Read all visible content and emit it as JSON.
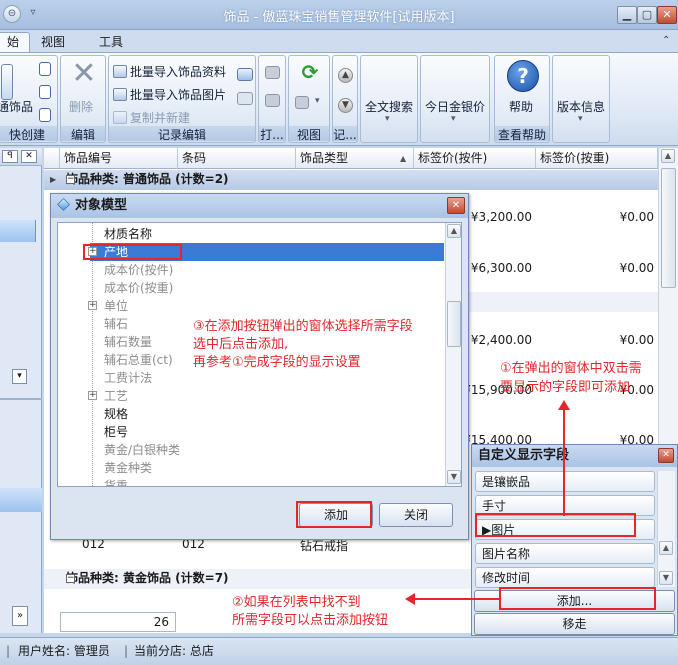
{
  "window": {
    "title": "饰品 - 傲蓝珠宝销售管理软件[试用版本]",
    "min": "▁",
    "max": "▢",
    "close": "✕"
  },
  "tabs": [
    {
      "label": "始"
    },
    {
      "label": "视图"
    },
    {
      "label": "工具"
    }
  ],
  "ribbon": {
    "create_cut": "通饰品",
    "create_group": "快创建",
    "delete": "删除",
    "edit_group": "编辑",
    "import_info": "批量导入饰品资料",
    "import_image": "批量导入饰品图片",
    "copy_new": "复制并新建",
    "record_group": "记录编辑",
    "print_group": "打...",
    "view_group": "视图",
    "record_group2": "记...",
    "fulltext_search": "全文搜索",
    "gold_price": "今日金银价",
    "help": "帮助",
    "view_help_group": "查看帮助",
    "version_info": "版本信息"
  },
  "left_pane": {
    "pin": "ꟼ",
    "close": "✕",
    "page_count": "26"
  },
  "grid": {
    "columns": [
      "饰品编号",
      "条码",
      "饰品类型",
      "标签价(按件)",
      "标签价(按重)"
    ],
    "group1": "饰品种类: 普通饰品 (计数=2)",
    "group2": "饰品种类: 黄金饰品 (计数=7)",
    "rows": [
      {
        "a": "¥3,200.00",
        "b": "¥0.00"
      },
      {
        "a": "¥6,300.00",
        "b": "¥0.00"
      },
      {
        "a": "¥2,400.00",
        "b": "¥0.00"
      },
      {
        "a": "¥15,900.00",
        "b": "¥0.00"
      },
      {
        "a": "¥15,400.00",
        "b": "¥0.00"
      }
    ],
    "last_row": {
      "code": "012",
      "barcode": "012",
      "type": "钻石戒指"
    }
  },
  "dialog": {
    "title": "对象模型",
    "items": [
      {
        "label": "材质名称",
        "disabled": false
      },
      {
        "label": "产地",
        "disabled": false
      },
      {
        "label": "成本价(按件)",
        "disabled": true
      },
      {
        "label": "成本价(按重)",
        "disabled": true
      },
      {
        "label": "单位",
        "disabled": true
      },
      {
        "label": "辅石",
        "disabled": true
      },
      {
        "label": "辅石数量",
        "disabled": true
      },
      {
        "label": "辅石总重(ct)",
        "disabled": true
      },
      {
        "label": "工费计法",
        "disabled": true
      },
      {
        "label": "工艺",
        "disabled": true
      },
      {
        "label": "规格",
        "disabled": false
      },
      {
        "label": "柜号",
        "disabled": false
      },
      {
        "label": "黄金/白银种类",
        "disabled": true
      },
      {
        "label": "黄金种类",
        "disabled": true
      },
      {
        "label": "货重",
        "disabled": true
      }
    ],
    "add_button": "添加",
    "close_button": "关闭"
  },
  "customize": {
    "title": "自定义显示字段",
    "fields": [
      "是镶嵌品",
      "手寸",
      "▶图片",
      "图片名称",
      "修改时间"
    ],
    "add_button": "添加...",
    "remove_button": "移走"
  },
  "annotations": {
    "note3_line1": "③在添加按钮弹出的窗体选择所需字段",
    "note3_line2": "选中后点击添加,",
    "note3_line3": "再参考①完成字段的显示设置",
    "note1_line1": "①在弹出的窗体中双击需",
    "note1_line2": "要显示的字段即可添加",
    "note2_line1": "②如果在列表中找不到",
    "note2_line2": "所需字段可以点击添加按钮"
  },
  "status": {
    "user": "用户姓名: 管理员",
    "branch": "当前分店: 总店"
  },
  "colors": {
    "annotation_red": "#e5262b",
    "selection_blue": "#3a7bd5",
    "group_header": "#c5d4eb"
  }
}
